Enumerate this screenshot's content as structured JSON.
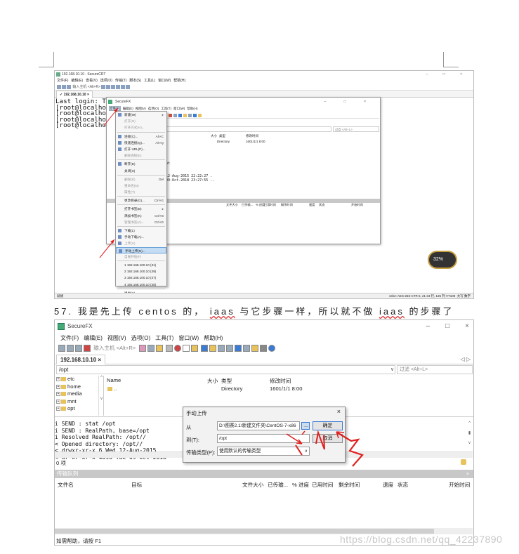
{
  "top_screenshot": {
    "title": "192.168.10.10 - SecureCRT",
    "window_controls": [
      "–",
      "□",
      "×"
    ],
    "menu": [
      "文件(F)",
      "编辑(E)",
      "查看(V)",
      "选项(O)",
      "传输(T)",
      "脚本(S)",
      "工具(L)",
      "窗口(W)",
      "帮助(H)"
    ],
    "toolbar_hint": "输入主机 <Alt+R>",
    "tab": "192.168.10.10",
    "terminal_lines": [
      "Last login: Tue",
      "[root@localhost",
      "[root@localhost",
      "[root@localhost",
      "[root@localhost"
    ],
    "status_left": "就绪",
    "status_right": "ssh2: AES-256-CTR      5, 21   34 行, 125 列 VT100",
    "status_caps": "大写 数字",
    "gauge_value": "32%",
    "sfx_window": {
      "title": "SecureFX",
      "window_controls": [
        "–",
        "□",
        "×"
      ],
      "menu": [
        "文件(F)",
        "编辑(E)",
        "视图(V)",
        "选项(O)",
        "工具(T)",
        "窗口(W)",
        "帮助(H)"
      ],
      "filter_placeholder": "过滤 <Alt+L>",
      "list_header": [
        "大小",
        "类型",
        "修改时间"
      ],
      "list_row": [
        "Directory",
        "1601/1/1 8:00"
      ],
      "log_lines": [
        "/opt",
        "e/",
        "//",
        "d 12-Aug-2015 22:22:27 .",
        "e 09-Oct-2018 23:27:55 .."
      ],
      "queue_cols": [
        "文件大小",
        "已传输...",
        "% 进度",
        "已用时间",
        "剩余时间",
        "速度",
        "状态",
        "开始时间"
      ],
      "file_menu": [
        {
          "label": "新建(W)",
          "shortcut": "",
          "icon": "new-icon",
          "state": "normal",
          "arrow": true
        },
        {
          "label": "打开(O)",
          "shortcut": "",
          "icon": "",
          "state": "disabled"
        },
        {
          "label": "打开方式(H)...",
          "shortcut": "",
          "icon": "",
          "state": "disabled"
        },
        {
          "sep": true
        },
        {
          "label": "连接(C)...",
          "shortcut": "Alt+C",
          "icon": "connect-icon",
          "state": "normal"
        },
        {
          "label": "快速连接(Q)...",
          "shortcut": "Alt+Q",
          "icon": "quick-connect-icon",
          "state": "normal"
        },
        {
          "label": "打开 URL(P)...",
          "shortcut": "",
          "icon": "url-icon",
          "state": "normal"
        },
        {
          "label": "删除连接(E)",
          "shortcut": "",
          "icon": "",
          "state": "disabled"
        },
        {
          "sep": true
        },
        {
          "label": "断开(D)",
          "shortcut": "",
          "icon": "disconnect-icon",
          "state": "normal"
        },
        {
          "label": "关闭(S)",
          "shortcut": "",
          "icon": "",
          "state": "normal"
        },
        {
          "sep": true
        },
        {
          "label": "删除(D)",
          "shortcut": "Del",
          "icon": "",
          "state": "disabled"
        },
        {
          "label": "重命名(M)",
          "shortcut": "",
          "icon": "",
          "state": "disabled"
        },
        {
          "label": "属性(T)",
          "shortcut": "",
          "icon": "",
          "state": "disabled"
        },
        {
          "sep": true
        },
        {
          "label": "更改目录(G)...",
          "shortcut": "Ctrl+G",
          "icon": "",
          "state": "normal"
        },
        {
          "sep": true
        },
        {
          "label": "打开书签(B)",
          "shortcut": "",
          "icon": "",
          "state": "normal",
          "arrow": true
        },
        {
          "label": "添加书签(K)",
          "shortcut": "Ctrl+B",
          "icon": "",
          "state": "normal"
        },
        {
          "label": "管理书签(A)...",
          "shortcut": "Ctrl+D",
          "icon": "",
          "state": "disabled"
        },
        {
          "sep": true
        },
        {
          "label": "下载(L)",
          "shortcut": "",
          "icon": "download-icon",
          "state": "normal"
        },
        {
          "label": "手动下载(A)...",
          "shortcut": "",
          "icon": "manual-download-icon",
          "state": "normal"
        },
        {
          "label": "上传(U)",
          "shortcut": "",
          "icon": "upload-icon",
          "state": "disabled"
        },
        {
          "label": "手动上传(N)...",
          "shortcut": "",
          "icon": "manual-upload-icon",
          "state": "highlight"
        },
        {
          "label": "自展开始(F)",
          "shortcut": "",
          "icon": "",
          "state": "disabled"
        },
        {
          "sep": true
        },
        {
          "label": "1 192.168.100.10 (31)",
          "shortcut": "",
          "icon": "",
          "state": "normal"
        },
        {
          "label": "2 192.168.100.10 (29)",
          "shortcut": "",
          "icon": "",
          "state": "normal"
        },
        {
          "label": "3 192.168.100.10 (27)",
          "shortcut": "",
          "icon": "",
          "state": "normal"
        },
        {
          "label": "4 192.168.100.10 (25)",
          "shortcut": "",
          "icon": "",
          "state": "normal"
        },
        {
          "sep": true
        },
        {
          "label": "退出(X)",
          "shortcut": "",
          "icon": "",
          "state": "normal"
        }
      ]
    }
  },
  "caption": {
    "num": "57.",
    "p1": "我是先上传 centos 的，",
    "iaas1": "iaas",
    "p2": "与它步骤一样，所以就不做",
    "iaas2": "iaas",
    "p3": "的步骤了"
  },
  "bottom_screenshot": {
    "title": "SecureFX",
    "window_controls": [
      "–",
      "□",
      "×"
    ],
    "menu": [
      "文件(F)",
      "编辑(E)",
      "视图(V)",
      "选项(O)",
      "工具(T)",
      "窗口(W)",
      "帮助(H)"
    ],
    "toolbar_hint": "输入主机 <Alt+R>",
    "tab": "192.168.10.10",
    "tab_nav": "◁ ▷",
    "path": "/opt",
    "filter_placeholder": "过滤 <Alt+L>",
    "tree": [
      "etc",
      "home",
      "media",
      "mnt",
      "opt"
    ],
    "list_headers": {
      "name": "Name",
      "size": "大小",
      "type": "类型",
      "modified": "修改时间"
    },
    "list_rows": [
      {
        "name": "..",
        "type": "Directory",
        "modified": "1601/1/1 8:00"
      }
    ],
    "log_lines": [
      "i SEND : stat /opt",
      "i SEND : RealPath, base=/opt",
      "i Resolved RealPath: /opt//",
      "< Opened directory: /opt//",
      "< drwxr-xr-x       6 Wed 12-Aug-2015",
      "< dr-xr-xr-x    4096 Tue 09-Oct-2018"
    ],
    "item_count": "0 项",
    "queue_title": "传输队列",
    "queue_cols": [
      "文件名",
      "目标",
      "文件大小",
      "已传输...",
      "% 进度",
      "已用时间",
      "剩余时间",
      "速度",
      "状态",
      "开始时间"
    ],
    "status": "如需帮助，请按 F1",
    "dialog": {
      "title": "手动上传",
      "from_label": "从",
      "from_value": "D:\\图赛2.1\\新建文件夹\\CentOS-7-x86",
      "browse": "...",
      "ok": "确定",
      "to_label": "到(T):",
      "to_value": "/opt",
      "cancel": "取消",
      "type_label": "传输类型(P):",
      "type_value": "使用默认的传输类型"
    },
    "annotations": [
      "1",
      "2",
      "3"
    ]
  },
  "watermark": "https://blog.csdn.net/qq_42237890",
  "colors": {
    "annotation_red": "#e02020",
    "highlight": "#c4dcf4",
    "gauge_ring": "#c8a040"
  }
}
